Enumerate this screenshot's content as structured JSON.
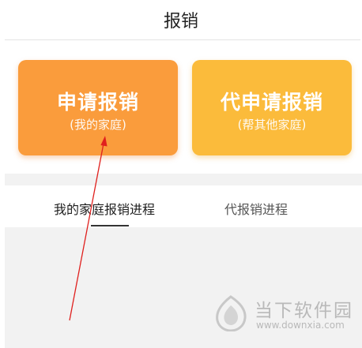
{
  "header": {
    "title": "报销"
  },
  "cards": [
    {
      "title": "申请报销",
      "subtitle": "(我的家庭)"
    },
    {
      "title": "代申请报销",
      "subtitle": "(帮其他家庭)"
    }
  ],
  "tabs": [
    {
      "label": "我的家庭报销进程",
      "selected": true
    },
    {
      "label": "代报销进程",
      "selected": false
    }
  ],
  "watermark": {
    "name": "当下软件园",
    "url": "www.downxia.com"
  },
  "colors": {
    "card_self": "#fa9c3c",
    "card_other": "#fbbb3b",
    "annotation_arrow": "#e0201e",
    "page_background": "#f2f2f2"
  }
}
